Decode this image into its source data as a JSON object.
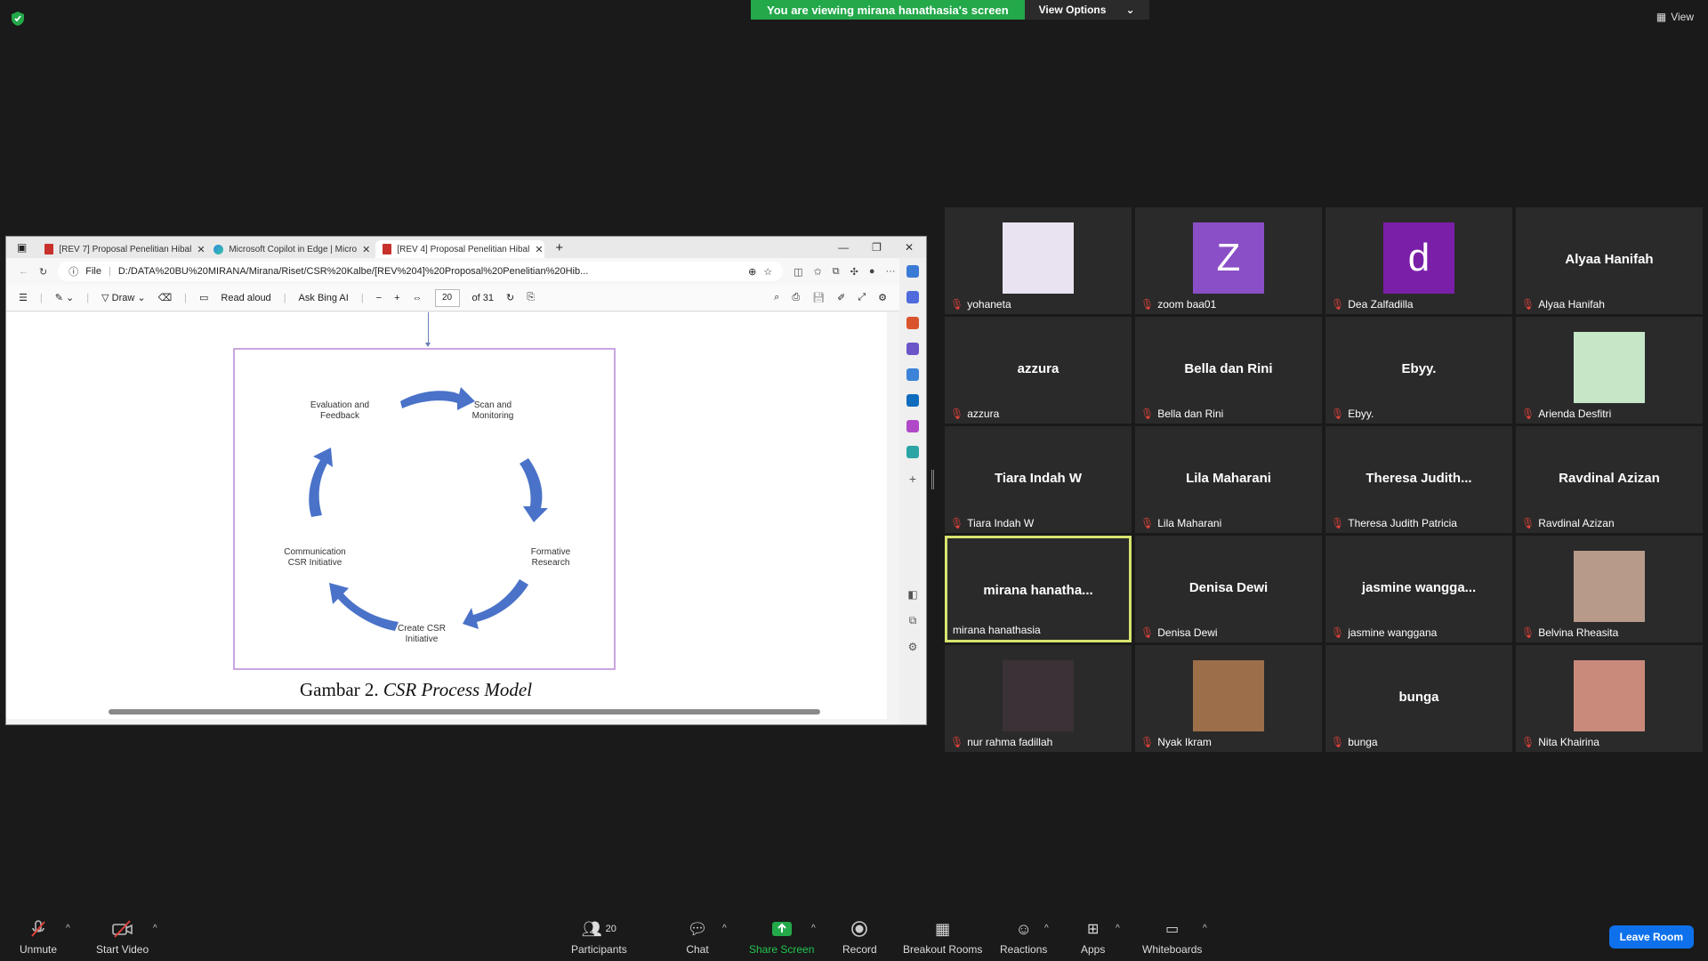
{
  "banner": {
    "message": "You are viewing mirana hanathasia's screen",
    "options": "View Options"
  },
  "view_label": "View",
  "shared_screen": {
    "tabs": [
      {
        "title": "[REV 7] Proposal Penelitian Hibal"
      },
      {
        "title": "Microsoft Copilot in Edge | Micro"
      },
      {
        "title": "[REV 4] Proposal Penelitian Hibal"
      }
    ],
    "address": {
      "prefix": "File",
      "url": "D:/DATA%20BU%20MIRANA/Mirana/Riset/CSR%20Kalbe/[REV%204]%20Proposal%20Penelitian%20Hib..."
    },
    "pdf_toolbar": {
      "draw": "Draw",
      "read_aloud": "Read aloud",
      "ask_bing": "Ask Bing AI",
      "page": "20",
      "page_total": "of 31"
    },
    "diagram": {
      "labels": {
        "eval": "Evaluation and Feedback",
        "scan": "Scan and Monitoring",
        "formative": "Formative Research",
        "create": "Create CSR Initiative",
        "communication": "Communication CSR Initiative"
      },
      "caption_prefix": "Gambar 2.",
      "caption_title": "CSR Process Model"
    }
  },
  "participants": [
    {
      "name": "yohaneta",
      "display": "",
      "avatar": "image",
      "color": "#e9e2f0"
    },
    {
      "name": "zoom baa01",
      "display": "",
      "avatar": "Z",
      "color": "#8a4fc7"
    },
    {
      "name": "Dea Zalfadilla",
      "display": "",
      "avatar": "d",
      "color": "#7a1fa8"
    },
    {
      "name": "Alyaa Hanifah",
      "display": "Alyaa Hanifah",
      "avatar": "",
      "color": ""
    },
    {
      "name": "azzura",
      "display": "azzura",
      "avatar": "",
      "color": ""
    },
    {
      "name": "Bella dan Rini",
      "display": "Bella dan Rini",
      "avatar": "",
      "color": ""
    },
    {
      "name": "Ebyy.",
      "display": "Ebyy.",
      "avatar": "",
      "color": ""
    },
    {
      "name": "Arienda Desfitri",
      "display": "",
      "avatar": "image",
      "color": "#c5e7c8"
    },
    {
      "name": "Tiara Indah W",
      "display": "Tiara Indah W",
      "avatar": "",
      "color": ""
    },
    {
      "name": "Lila Maharani",
      "display": "Lila Maharani",
      "avatar": "",
      "color": ""
    },
    {
      "name": "Theresa Judith Patricia",
      "display": "Theresa  Judith...",
      "avatar": "",
      "color": ""
    },
    {
      "name": "Ravdinal Azizan",
      "display": "Ravdinal Azizan",
      "avatar": "",
      "color": ""
    },
    {
      "name": "mirana hanathasia",
      "display": "mirana  hanatha...",
      "avatar": "",
      "color": "",
      "speaking": true
    },
    {
      "name": "Denisa Dewi",
      "display": "Denisa Dewi",
      "avatar": "",
      "color": ""
    },
    {
      "name": "jasmine wanggana",
      "display": "jasmine  wangga...",
      "avatar": "",
      "color": ""
    },
    {
      "name": "Belvina Rheasita",
      "display": "",
      "avatar": "image",
      "color": "#b89a8a"
    },
    {
      "name": "nur rahma fadillah",
      "display": "",
      "avatar": "image",
      "color": "#3a3236"
    },
    {
      "name": "Nyak Ikram",
      "display": "",
      "avatar": "image",
      "color": "#9c6f4a"
    },
    {
      "name": "bunga",
      "display": "bunga",
      "avatar": "",
      "color": ""
    },
    {
      "name": "Nita Khairina",
      "display": "",
      "avatar": "image",
      "color": "#c98a7c"
    }
  ],
  "toolbar": {
    "unmute": "Unmute",
    "start_video": "Start Video",
    "participants": "Participants",
    "participants_count": "20",
    "chat": "Chat",
    "share_screen": "Share Screen",
    "record": "Record",
    "breakout_rooms": "Breakout Rooms",
    "reactions": "Reactions",
    "apps": "Apps",
    "whiteboards": "Whiteboards",
    "leave": "Leave Room"
  }
}
